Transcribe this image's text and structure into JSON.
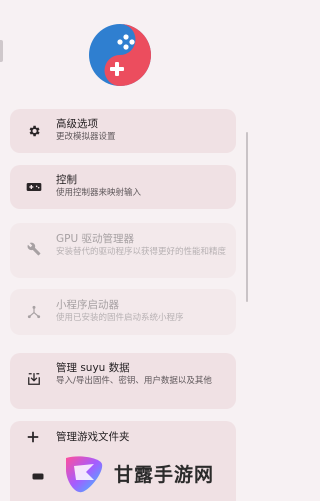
{
  "settings_menu": [
    {
      "title": "高级选项",
      "description": "更改模拟器设置",
      "icon": "gear-icon",
      "enabled": true
    },
    {
      "title": "控制",
      "description": "使用控制器来映射输入",
      "icon": "gamepad-icon",
      "enabled": true
    },
    {
      "title": "GPU 驱动管理器",
      "description": "安装替代的驱动程序以获得更好的性能和精度",
      "icon": "wrench-icon",
      "enabled": false
    },
    {
      "title": "小程序启动器",
      "description": "使用已安装的固件启动系统小程序",
      "icon": "share-nodes-icon",
      "enabled": false
    },
    {
      "title": "管理 suyu 数据",
      "description": "导入/导出固件、密钥、用户数据以及其他",
      "icon": "download-box-icon",
      "enabled": true
    },
    {
      "title": "管理游戏文件夹",
      "description": "",
      "icon": "plus-icon",
      "enabled": true
    }
  ],
  "watermark": {
    "text": "甘露手游网"
  },
  "colors": {
    "logo_blue": "#2f7fd0",
    "logo_red": "#ec4d5e",
    "card_bg": "#f0e1e4",
    "page_bg": "#f7f1f3"
  }
}
